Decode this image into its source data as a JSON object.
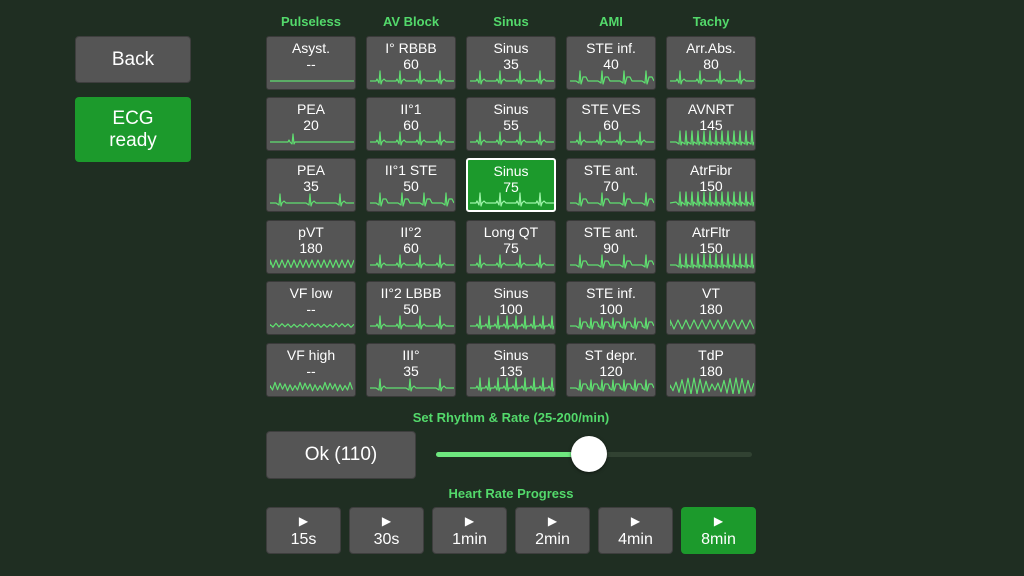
{
  "buttons": {
    "back": "Back",
    "ecg_ready": "ECG\nready"
  },
  "colors": {
    "accent": "#53d96b",
    "button_active": "#1c9a2c",
    "tile_bg": "#555555",
    "trace": "#5fe070"
  },
  "columns": [
    {
      "header": "Pulseless",
      "tiles": [
        {
          "name": "Asyst.",
          "rate": "--",
          "wave": "flat"
        },
        {
          "name": "PEA",
          "rate": "20",
          "wave": "pea-slow"
        },
        {
          "name": "PEA",
          "rate": "35",
          "wave": "pea"
        },
        {
          "name": "pVT",
          "rate": "180",
          "wave": "pvt"
        },
        {
          "name": "VF low",
          "rate": "--",
          "wave": "vf-low"
        },
        {
          "name": "VF high",
          "rate": "--",
          "wave": "vf-high"
        }
      ]
    },
    {
      "header": "AV Block",
      "tiles": [
        {
          "name": "I° RBBB",
          "rate": "60",
          "wave": "sinus"
        },
        {
          "name": "II°1",
          "rate": "60",
          "wave": "sinus"
        },
        {
          "name": "II°1 STE",
          "rate": "50",
          "wave": "ste"
        },
        {
          "name": "II°2",
          "rate": "60",
          "wave": "sinus"
        },
        {
          "name": "II°2 LBBB",
          "rate": "50",
          "wave": "sinus"
        },
        {
          "name": "III°",
          "rate": "35",
          "wave": "pea"
        }
      ]
    },
    {
      "header": "Sinus",
      "tiles": [
        {
          "name": "Sinus",
          "rate": "35",
          "wave": "sinus"
        },
        {
          "name": "Sinus",
          "rate": "55",
          "wave": "sinus"
        },
        {
          "name": "Sinus",
          "rate": "75",
          "wave": "sinus",
          "selected": true
        },
        {
          "name": "Long QT",
          "rate": "75",
          "wave": "sinus"
        },
        {
          "name": "Sinus",
          "rate": "100",
          "wave": "sinus-fast"
        },
        {
          "name": "Sinus",
          "rate": "135",
          "wave": "sinus-fast"
        }
      ]
    },
    {
      "header": "AMI",
      "tiles": [
        {
          "name": "STE inf.",
          "rate": "40",
          "wave": "ste"
        },
        {
          "name": "STE VES",
          "rate": "60",
          "wave": "sinus"
        },
        {
          "name": "STE ant.",
          "rate": "70",
          "wave": "ste"
        },
        {
          "name": "STE ant.",
          "rate": "90",
          "wave": "ste"
        },
        {
          "name": "STE inf.",
          "rate": "100",
          "wave": "ste-fast"
        },
        {
          "name": "ST depr.",
          "rate": "120",
          "wave": "ste-fast"
        }
      ]
    },
    {
      "header": "Tachy",
      "tiles": [
        {
          "name": "Arr.Abs.",
          "rate": "80",
          "wave": "sinus"
        },
        {
          "name": "AVNRT",
          "rate": "145",
          "wave": "fast"
        },
        {
          "name": "AtrFibr",
          "rate": "150",
          "wave": "afib"
        },
        {
          "name": "AtrFltr",
          "rate": "150",
          "wave": "fast"
        },
        {
          "name": "VT",
          "rate": "180",
          "wave": "vt"
        },
        {
          "name": "TdP",
          "rate": "180",
          "wave": "tdp"
        }
      ]
    }
  ],
  "rate_section": {
    "label": "Set Rhythm & Rate (25-200/min)",
    "ok_label": "Ok (110)",
    "slider_min": 25,
    "slider_max": 200,
    "slider_value": 110
  },
  "progress_section": {
    "label": "Heart Rate Progress",
    "play_icon": "▶",
    "buttons": [
      {
        "label": "15s",
        "active": false
      },
      {
        "label": "30s",
        "active": false
      },
      {
        "label": "1min",
        "active": false
      },
      {
        "label": "2min",
        "active": false
      },
      {
        "label": "4min",
        "active": false
      },
      {
        "label": "8min",
        "active": true
      }
    ]
  }
}
